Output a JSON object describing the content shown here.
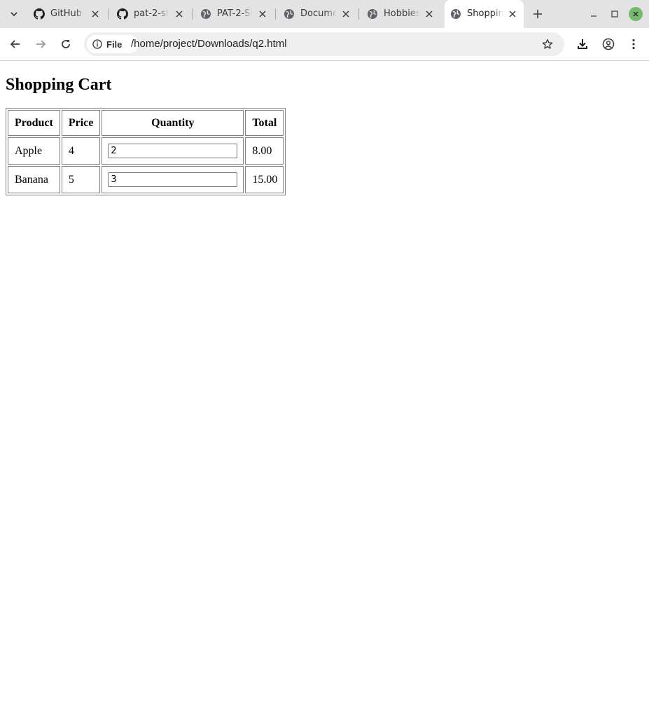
{
  "browser": {
    "tabs": [
      {
        "label": "GitHub (",
        "icon": "github-icon"
      },
      {
        "label": "pat-2-sh",
        "icon": "github-icon"
      },
      {
        "label": "PAT-2-SI",
        "icon": "globe-icon"
      },
      {
        "label": "Docume",
        "icon": "globe-icon"
      },
      {
        "label": "Hobbies",
        "icon": "globe-icon"
      },
      {
        "label": "Shoppin",
        "icon": "globe-icon",
        "active": true
      }
    ],
    "site_chip": "File",
    "url": "/home/project/Downloads/q2.html",
    "accent_close": "#79b870"
  },
  "page": {
    "heading": "Shopping Cart",
    "table": {
      "headers": {
        "product": "Product",
        "price": "Price",
        "quantity": "Quantity",
        "total": "Total"
      },
      "rows": [
        {
          "product": "Apple",
          "price": "4",
          "quantity": "2",
          "total": "8.00"
        },
        {
          "product": "Banana",
          "price": "5",
          "quantity": "3",
          "total": "15.00"
        }
      ]
    }
  }
}
